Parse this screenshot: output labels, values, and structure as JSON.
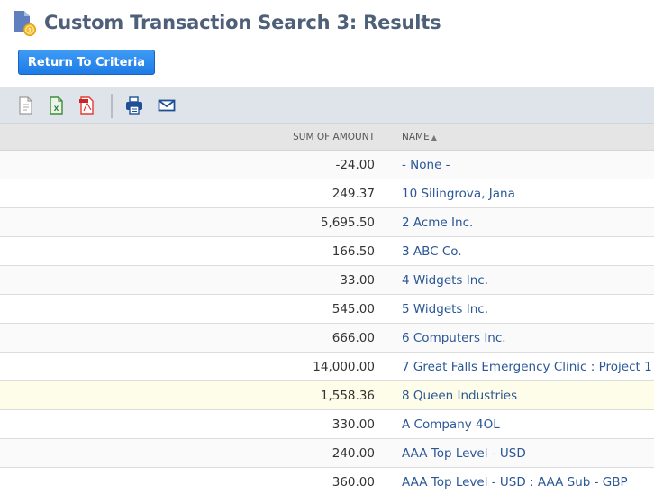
{
  "page": {
    "title": "Custom Transaction Search 3: Results",
    "title_icon": "search-results-document-icon"
  },
  "actions": {
    "return_label": "Return To Criteria"
  },
  "toolbar": {
    "icons": [
      {
        "name": "export-csv-icon",
        "color": "#9a9a9a"
      },
      {
        "name": "export-excel-icon",
        "color": "#3f8b3a"
      },
      {
        "name": "export-pdf-icon",
        "color": "#e53935"
      },
      {
        "name": "print-icon",
        "color": "#1f4f96"
      },
      {
        "name": "email-icon",
        "color": "#1f4f96"
      }
    ]
  },
  "table": {
    "columns": {
      "amount": "SUM OF AMOUNT",
      "name": "NAME",
      "sort_indicator": "▲"
    },
    "rows": [
      {
        "amount": "-24.00",
        "name": "- None -"
      },
      {
        "amount": "249.37",
        "name": "10 Silingrova, Jana"
      },
      {
        "amount": "5,695.50",
        "name": "2 Acme Inc."
      },
      {
        "amount": "166.50",
        "name": "3 ABC Co."
      },
      {
        "amount": "33.00",
        "name": "4 Widgets Inc."
      },
      {
        "amount": "545.00",
        "name": "5 Widgets Inc."
      },
      {
        "amount": "666.00",
        "name": "6 Computers Inc."
      },
      {
        "amount": "14,000.00",
        "name": "7 Great Falls Emergency Clinic : Project 1"
      },
      {
        "amount": "1,558.36",
        "name": "8 Queen Industries",
        "highlighted": true
      },
      {
        "amount": "330.00",
        "name": "A Company 4OL"
      },
      {
        "amount": "240.00",
        "name": "AAA Top Level - USD"
      },
      {
        "amount": "360.00",
        "name": "AAA Top Level - USD : AAA Sub - GBP"
      }
    ]
  },
  "colors": {
    "title": "#4d5f79",
    "button": "#2585ec",
    "link": "#2b5797",
    "toolbar_bg": "#dfe4eb",
    "header_bg": "#e5e5e5",
    "highlight_row": "#fdfde9"
  }
}
